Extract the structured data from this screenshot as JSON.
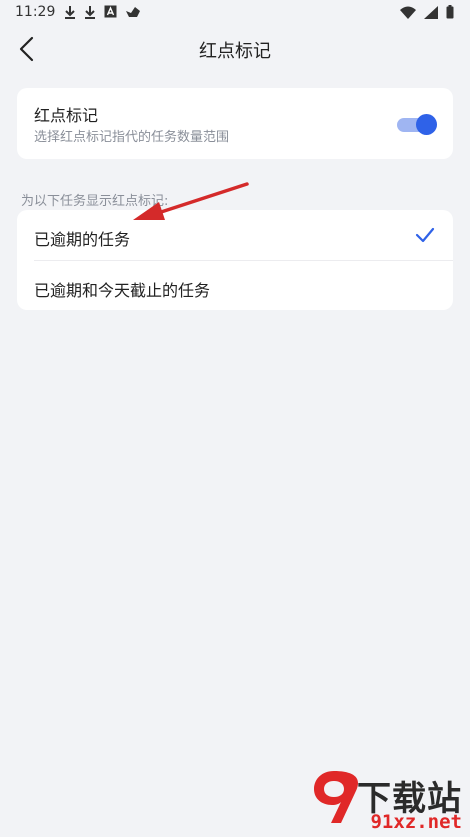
{
  "status_bar": {
    "time": "11:29",
    "icons": [
      "download-icon",
      "download-icon",
      "a-box-icon",
      "cloud-icon"
    ],
    "right_icons": [
      "wifi-icon",
      "signal-icon",
      "battery-icon"
    ]
  },
  "header": {
    "title": "红点标记",
    "back_icon": "chevron-left-icon"
  },
  "toggle_card": {
    "title": "红点标记",
    "subtitle": "选择红点标记指代的任务数量范围",
    "enabled": true
  },
  "section_label": "为以下任务显示红点标记:",
  "options": [
    {
      "label": "已逾期的任务",
      "selected": true
    },
    {
      "label": "已逾期和今天截止的任务",
      "selected": false
    }
  ],
  "watermark": {
    "brand": "下载站",
    "url": "91xz.net"
  },
  "colors": {
    "accent": "#2f62e8",
    "background": "#f2f3f6",
    "annotation_arrow": "#d42a2a"
  }
}
